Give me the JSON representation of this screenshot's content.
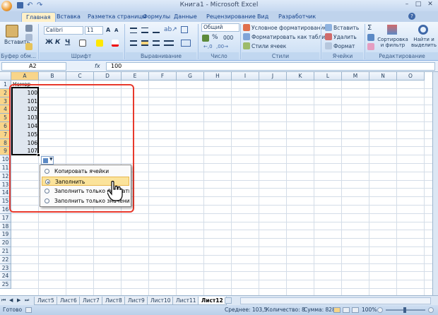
{
  "window": {
    "title": "Книга1 - Microsoft Excel"
  },
  "qat": {
    "office_button": "office-button"
  },
  "tabs": [
    "Главная",
    "Вставка",
    "Разметка страницы",
    "Формулы",
    "Данные",
    "Рецензирование",
    "Вид",
    "Разработчик"
  ],
  "ribbon": {
    "clipboard": {
      "paste": "Вставить",
      "label": "Буфер обм..."
    },
    "font": {
      "name": "Calibri",
      "size": "11",
      "bold": "Ж",
      "italic": "К",
      "underline": "Ч",
      "label": "Шрифт"
    },
    "alignment": {
      "label": "Выравнивание"
    },
    "number": {
      "format": "Общий",
      "percent": "%",
      "thousands": "000",
      "label": "Число"
    },
    "styles": {
      "conditional": "Условное форматирование",
      "table": "Форматировать как таблицу",
      "cell": "Стили ячеек",
      "label": "Стили"
    },
    "cells": {
      "insert": "Вставить",
      "delete": "Удалить",
      "format": "Формат",
      "label": "Ячейки"
    },
    "editing": {
      "sum": "Σ",
      "sort": "Сортировка и фильтр",
      "find": "Найти и выделить",
      "label": "Редактирование"
    }
  },
  "formula_bar": {
    "name_box": "A2",
    "fx": "fx",
    "value": "100"
  },
  "columns": [
    "A",
    "B",
    "C",
    "D",
    "E",
    "F",
    "G",
    "H",
    "I",
    "J",
    "K",
    "L",
    "M",
    "N",
    "O"
  ],
  "rows": [
    "1",
    "2",
    "3",
    "4",
    "5",
    "6",
    "7",
    "8",
    "9",
    "10",
    "11",
    "12",
    "13",
    "14",
    "15",
    "16",
    "17",
    "18",
    "19",
    "20",
    "21",
    "22",
    "23",
    "24",
    "25"
  ],
  "cells": {
    "a1": "Номер",
    "a_values": [
      "100",
      "101",
      "102",
      "103",
      "104",
      "105",
      "106",
      "107"
    ]
  },
  "autofill_menu": {
    "items": [
      "Копировать ячейки",
      "Заполнить",
      "Заполнить только форматы",
      "Заполнить только значения"
    ],
    "selected_index": 1
  },
  "sheets": [
    "Лист5",
    "Лист6",
    "Лист7",
    "Лист8",
    "Лист9",
    "Лист10",
    "Лист11",
    "Лист12"
  ],
  "active_sheet": "Лист12",
  "status": {
    "mode": "Готово",
    "average": "Среднее: 103,5",
    "count": "Количество: 8",
    "sum": "Сумма: 828",
    "zoom": "100%"
  },
  "colors": {
    "highlight": "#e8392c",
    "selection": "#f8d58a"
  }
}
